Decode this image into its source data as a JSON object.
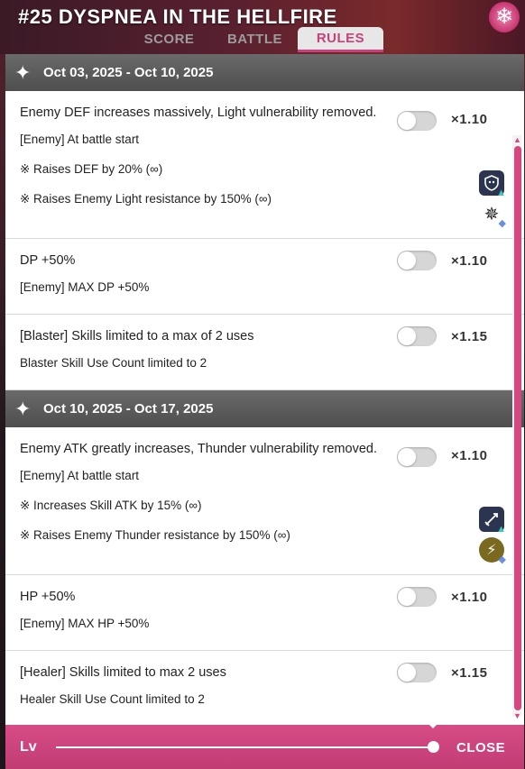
{
  "header": {
    "title": "#25 DYSPNEA IN THE HELLFIRE",
    "badge_icon": "snowflake-icon",
    "tabs": [
      {
        "label": "SCORE",
        "active": false
      },
      {
        "label": "BATTLE",
        "active": false
      },
      {
        "label": "RULES",
        "active": true
      }
    ]
  },
  "sections": [
    {
      "date_range": "Oct 03, 2025 - Oct 10, 2025",
      "rules": [
        {
          "title": "Enemy DEF increases massively, Light vulnerability removed.",
          "multiplier": "×1.10",
          "enabled": false,
          "lines": [
            {
              "text": "[Enemy] At battle start"
            },
            {
              "text": "※ Raises DEF by 20% (∞)",
              "icon": "def-up-icon"
            },
            {
              "text": "※ Raises Enemy Light resistance by 150% (∞)",
              "icon": "light-resist-icon"
            }
          ]
        },
        {
          "title": "DP +50%",
          "multiplier": "×1.10",
          "enabled": false,
          "lines": [
            {
              "text": "[Enemy] MAX DP +50%"
            }
          ]
        },
        {
          "title": "[Blaster] Skills limited to a max of 2 uses",
          "multiplier": "×1.15",
          "enabled": false,
          "lines": [
            {
              "text": "Blaster Skill Use Count limited to 2"
            }
          ]
        }
      ]
    },
    {
      "date_range": "Oct 10, 2025 - Oct 17, 2025",
      "rules": [
        {
          "title": "Enemy ATK greatly increases, Thunder vulnerability removed.",
          "multiplier": "×1.10",
          "enabled": false,
          "lines": [
            {
              "text": "[Enemy] At battle start"
            },
            {
              "text": "※ Increases Skill ATK by 15% (∞)",
              "icon": "skill-atk-up-icon"
            },
            {
              "text": "※ Raises Enemy Thunder resistance by 150% (∞)",
              "icon": "thunder-resist-icon"
            }
          ]
        },
        {
          "title": "HP +50%",
          "multiplier": "×1.10",
          "enabled": false,
          "lines": [
            {
              "text": "[Enemy] MAX HP +50%"
            }
          ]
        },
        {
          "title": "[Healer] Skills limited to max 2 uses",
          "multiplier": "×1.15",
          "enabled": false,
          "lines": [
            {
              "text": "Healer Skill Use Count limited to 2"
            }
          ]
        }
      ]
    }
  ],
  "footer": {
    "level_label": "Lv",
    "level_fraction": 1.0,
    "close_label": "CLOSE"
  },
  "colors": {
    "accent": "#d4487f",
    "section_header": "#5a5a5a",
    "toggle_off": "#d6d6d6"
  }
}
